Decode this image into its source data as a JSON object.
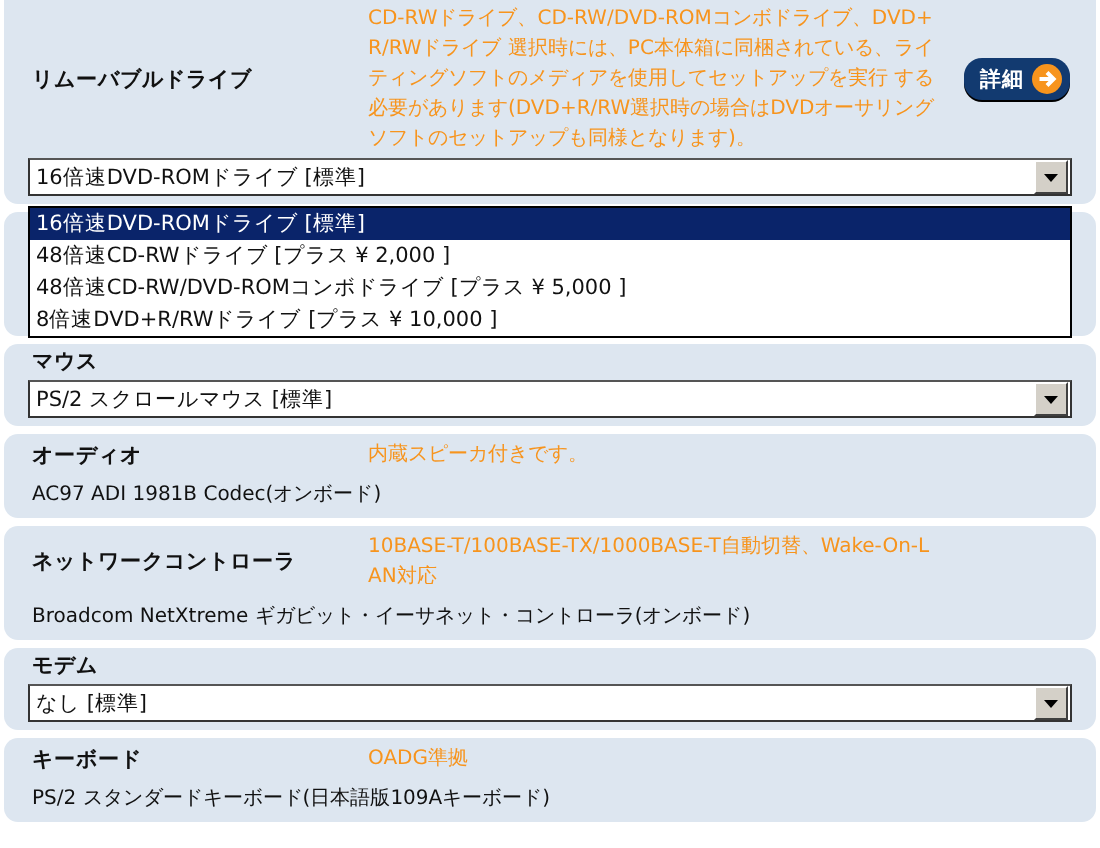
{
  "sections": [
    {
      "kind": "select",
      "label": "リムーバブルドライブ",
      "note": "CD-RWドライブ、CD-RW/DVD-ROMコンボドライブ、DVD+R/RWドライブ 選択時には、PC本体箱に同梱されている、ライティングソフトのメディアを使用してセットアップを実行 する必要があります(DVD+R/RW選択時の場合はDVDオーサリングソフトのセットアップも同様となります)。",
      "detail_button": "詳細",
      "value": "16倍速DVD-ROMドライブ [標準]",
      "expanded": true,
      "options": [
        {
          "label": "16倍速DVD-ROMドライブ [標準]",
          "selected": true
        },
        {
          "label": "48倍速CD-RWドライブ [プラス ¥ 2,000 ]",
          "selected": false
        },
        {
          "label": "48倍速CD-RW/DVD-ROMコンボドライブ [プラス ¥ 5,000 ]",
          "selected": false
        },
        {
          "label": "8倍速DVD+R/RWドライブ [プラス ¥ 10,000 ]",
          "selected": false
        }
      ]
    },
    {
      "kind": "select",
      "label": "マウス",
      "value": "PS/2 スクロールマウス [標準]"
    },
    {
      "kind": "text",
      "label": "オーディオ",
      "note": "内蔵スピーカ付きです。",
      "value": "AC97 ADI 1981B Codec(オンボード)"
    },
    {
      "kind": "text",
      "label": "ネットワークコントローラ",
      "note": "10BASE-T/100BASE-TX/1000BASE-T自動切替、Wake-On-LAN対応",
      "value": "Broadcom NetXtreme ギガビット・イーサネット・コントローラ(オンボード)"
    },
    {
      "kind": "select",
      "label": "モデム",
      "value": "なし [標準]"
    },
    {
      "kind": "text",
      "label": "キーボード",
      "note": "OADG準拠",
      "value": "PS/2 スタンダードキーボード(日本語版109Aキーボード)"
    }
  ]
}
